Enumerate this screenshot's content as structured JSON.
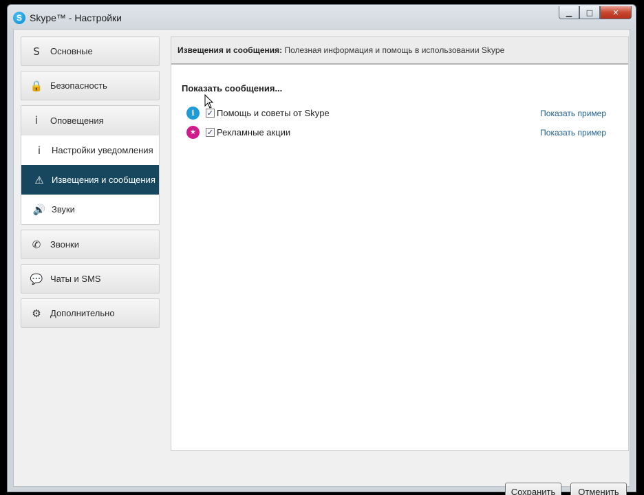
{
  "window": {
    "title": "Skype™ - Настройки",
    "icon": "skype-icon",
    "minimize": "▁",
    "maximize": "□",
    "close": "✕"
  },
  "sidebar": {
    "items": [
      {
        "label": "Основные",
        "icon": "skype-icon",
        "glyph": "S"
      },
      {
        "label": "Безопасность",
        "icon": "lock-icon",
        "glyph": "🔒"
      },
      {
        "label": "Оповещения",
        "icon": "info-icon",
        "glyph": "i"
      },
      {
        "label": "Звонки",
        "icon": "phone-icon",
        "glyph": "✆"
      },
      {
        "label": "Чаты и SMS",
        "icon": "chat-icon",
        "glyph": "💬"
      },
      {
        "label": "Дополнительно",
        "icon": "gear-icon",
        "glyph": "⚙"
      }
    ],
    "subitems": [
      {
        "label": "Настройки уведомления",
        "icon": "info-icon",
        "glyph": "i",
        "active": false
      },
      {
        "label": "Извещения и сообщения",
        "icon": "warning-icon",
        "glyph": "⚠",
        "active": true
      },
      {
        "label": "Звуки",
        "icon": "speaker-icon",
        "glyph": "🔊",
        "active": false
      }
    ]
  },
  "content": {
    "header_bold": "Извещения и сообщения:",
    "header_text": " Полезная информация и помощь в использовании Skype",
    "section_title": "Показать сообщения...",
    "rows": [
      {
        "icon": "info-icon",
        "glyph": "i",
        "color": "#1e9bd7",
        "checked": true,
        "check_glyph": "✓",
        "label": "Помощь и советы от Skype",
        "link": "Показать пример"
      },
      {
        "icon": "star-icon",
        "glyph": "★",
        "color": "#d01c8b",
        "checked": true,
        "check_glyph": "✓",
        "label": "Рекламные акции",
        "link": "Показать пример"
      }
    ]
  },
  "footer": {
    "save_label": "Сохранить",
    "cancel_label": "Отменить"
  }
}
